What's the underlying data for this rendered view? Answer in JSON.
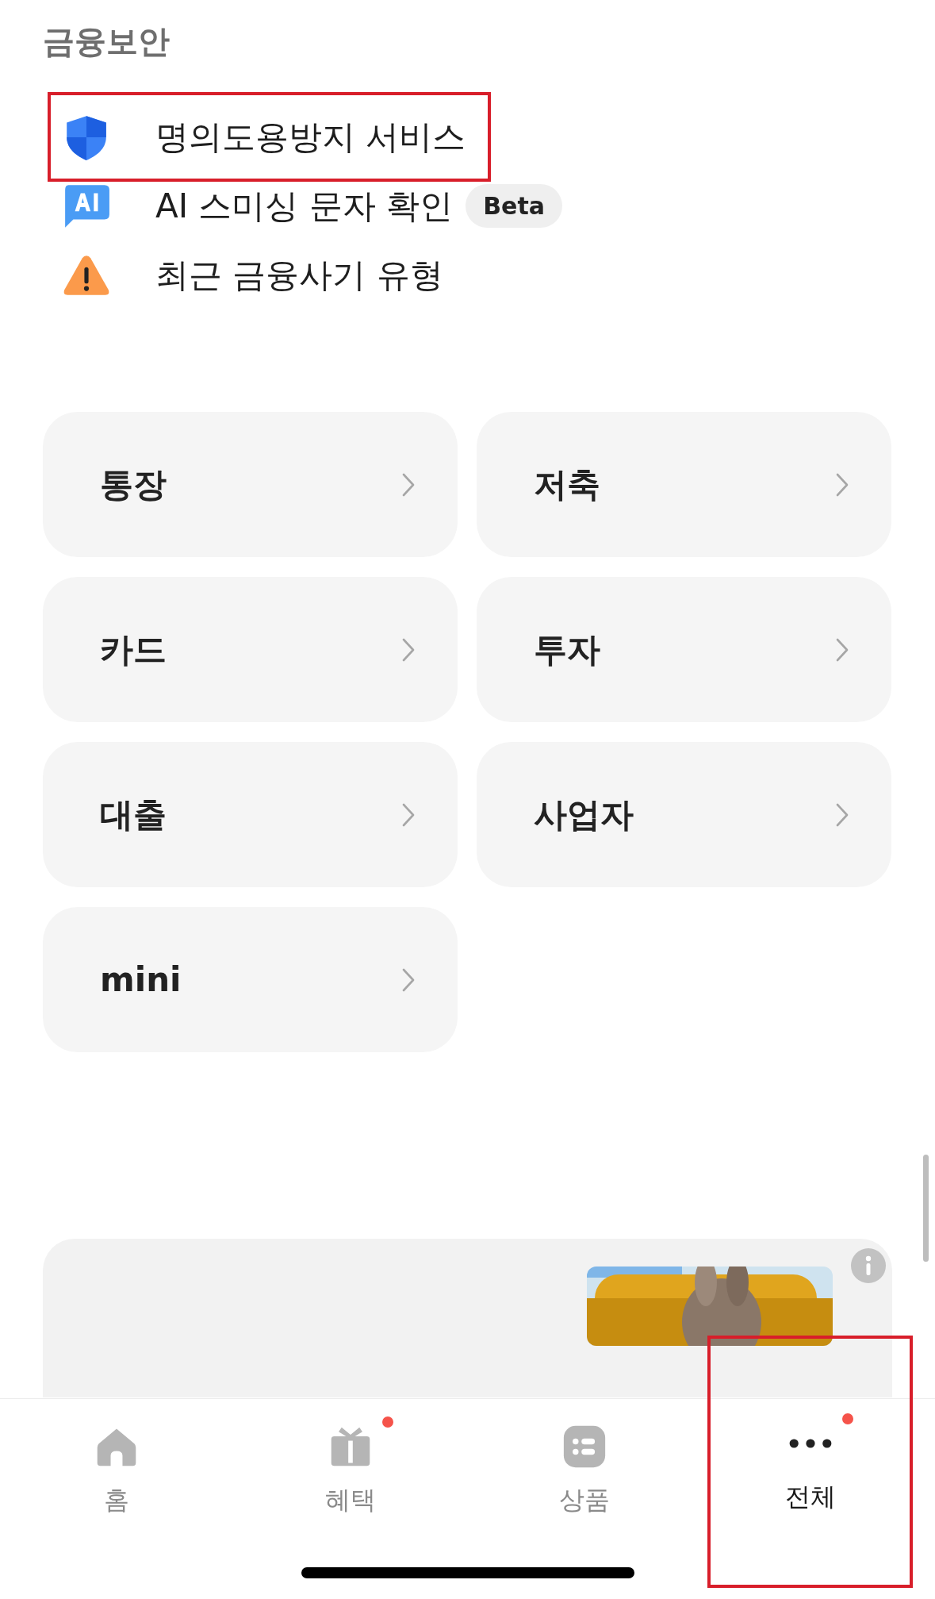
{
  "section_title": "금융보안",
  "security_items": [
    {
      "kind": "shield",
      "label": "명의도용방지 서비스",
      "highlighted": true
    },
    {
      "kind": "ai",
      "label": "AI 스미싱 문자 확인",
      "badge": "Beta",
      "highlighted": false
    },
    {
      "kind": "warning",
      "label": "최근 금융사기 유형",
      "highlighted": false
    }
  ],
  "categories": [
    {
      "label": "통장"
    },
    {
      "label": "저축"
    },
    {
      "label": "카드"
    },
    {
      "label": "투자"
    },
    {
      "label": "대출"
    },
    {
      "label": "사업자"
    },
    {
      "label": "mini"
    }
  ],
  "nav": [
    {
      "kind": "home",
      "label": "홈",
      "selected": false,
      "dot": false,
      "highlighted": false
    },
    {
      "kind": "gift",
      "label": "혜택",
      "selected": false,
      "dot": true,
      "highlighted": false
    },
    {
      "kind": "list",
      "label": "상품",
      "selected": false,
      "dot": false,
      "highlighted": false
    },
    {
      "kind": "more",
      "label": "전체",
      "selected": true,
      "dot": true,
      "highlighted": true
    }
  ]
}
